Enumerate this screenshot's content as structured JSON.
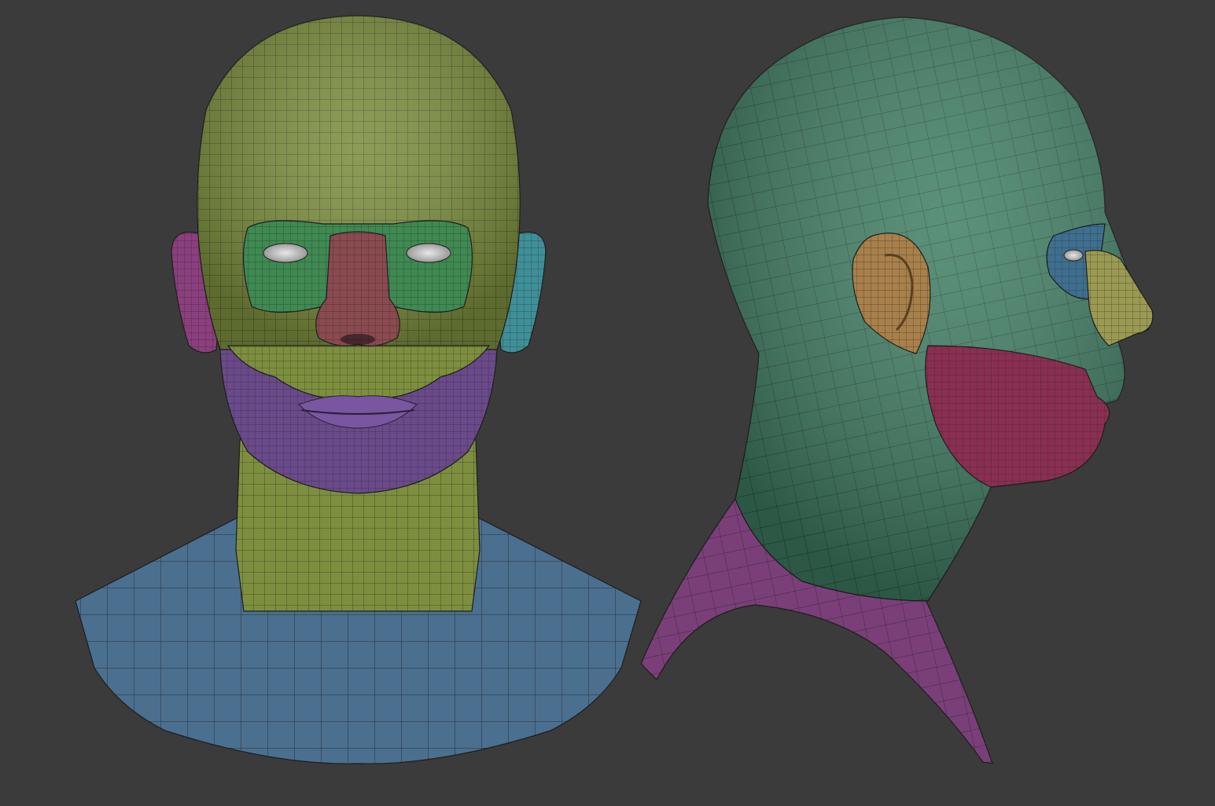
{
  "scene": {
    "background": "#3b3b3b",
    "views": [
      {
        "name": "front-view",
        "regions": [
          {
            "name": "head",
            "color": "#7d8f3e"
          },
          {
            "name": "neck",
            "color": "#7d8f3e"
          },
          {
            "name": "shoulders",
            "color": "#4b6f8f"
          },
          {
            "name": "chin-jaw",
            "color": "#6a4a8a"
          },
          {
            "name": "eye-area",
            "color": "#3f8a52"
          },
          {
            "name": "nose",
            "color": "#8a4a4f"
          },
          {
            "name": "ear-left",
            "color": "#8b3f7e"
          },
          {
            "name": "ear-right",
            "color": "#3f8f98"
          }
        ]
      },
      {
        "name": "side-view",
        "regions": [
          {
            "name": "head",
            "color": "#3e7d62"
          },
          {
            "name": "collar",
            "color": "#7a3f78"
          },
          {
            "name": "cheek-jaw",
            "color": "#8a2f52"
          },
          {
            "name": "nose",
            "color": "#9a9a52"
          },
          {
            "name": "eye-area",
            "color": "#3f6f8f"
          },
          {
            "name": "ear",
            "color": "#a8804a"
          }
        ]
      }
    ]
  }
}
